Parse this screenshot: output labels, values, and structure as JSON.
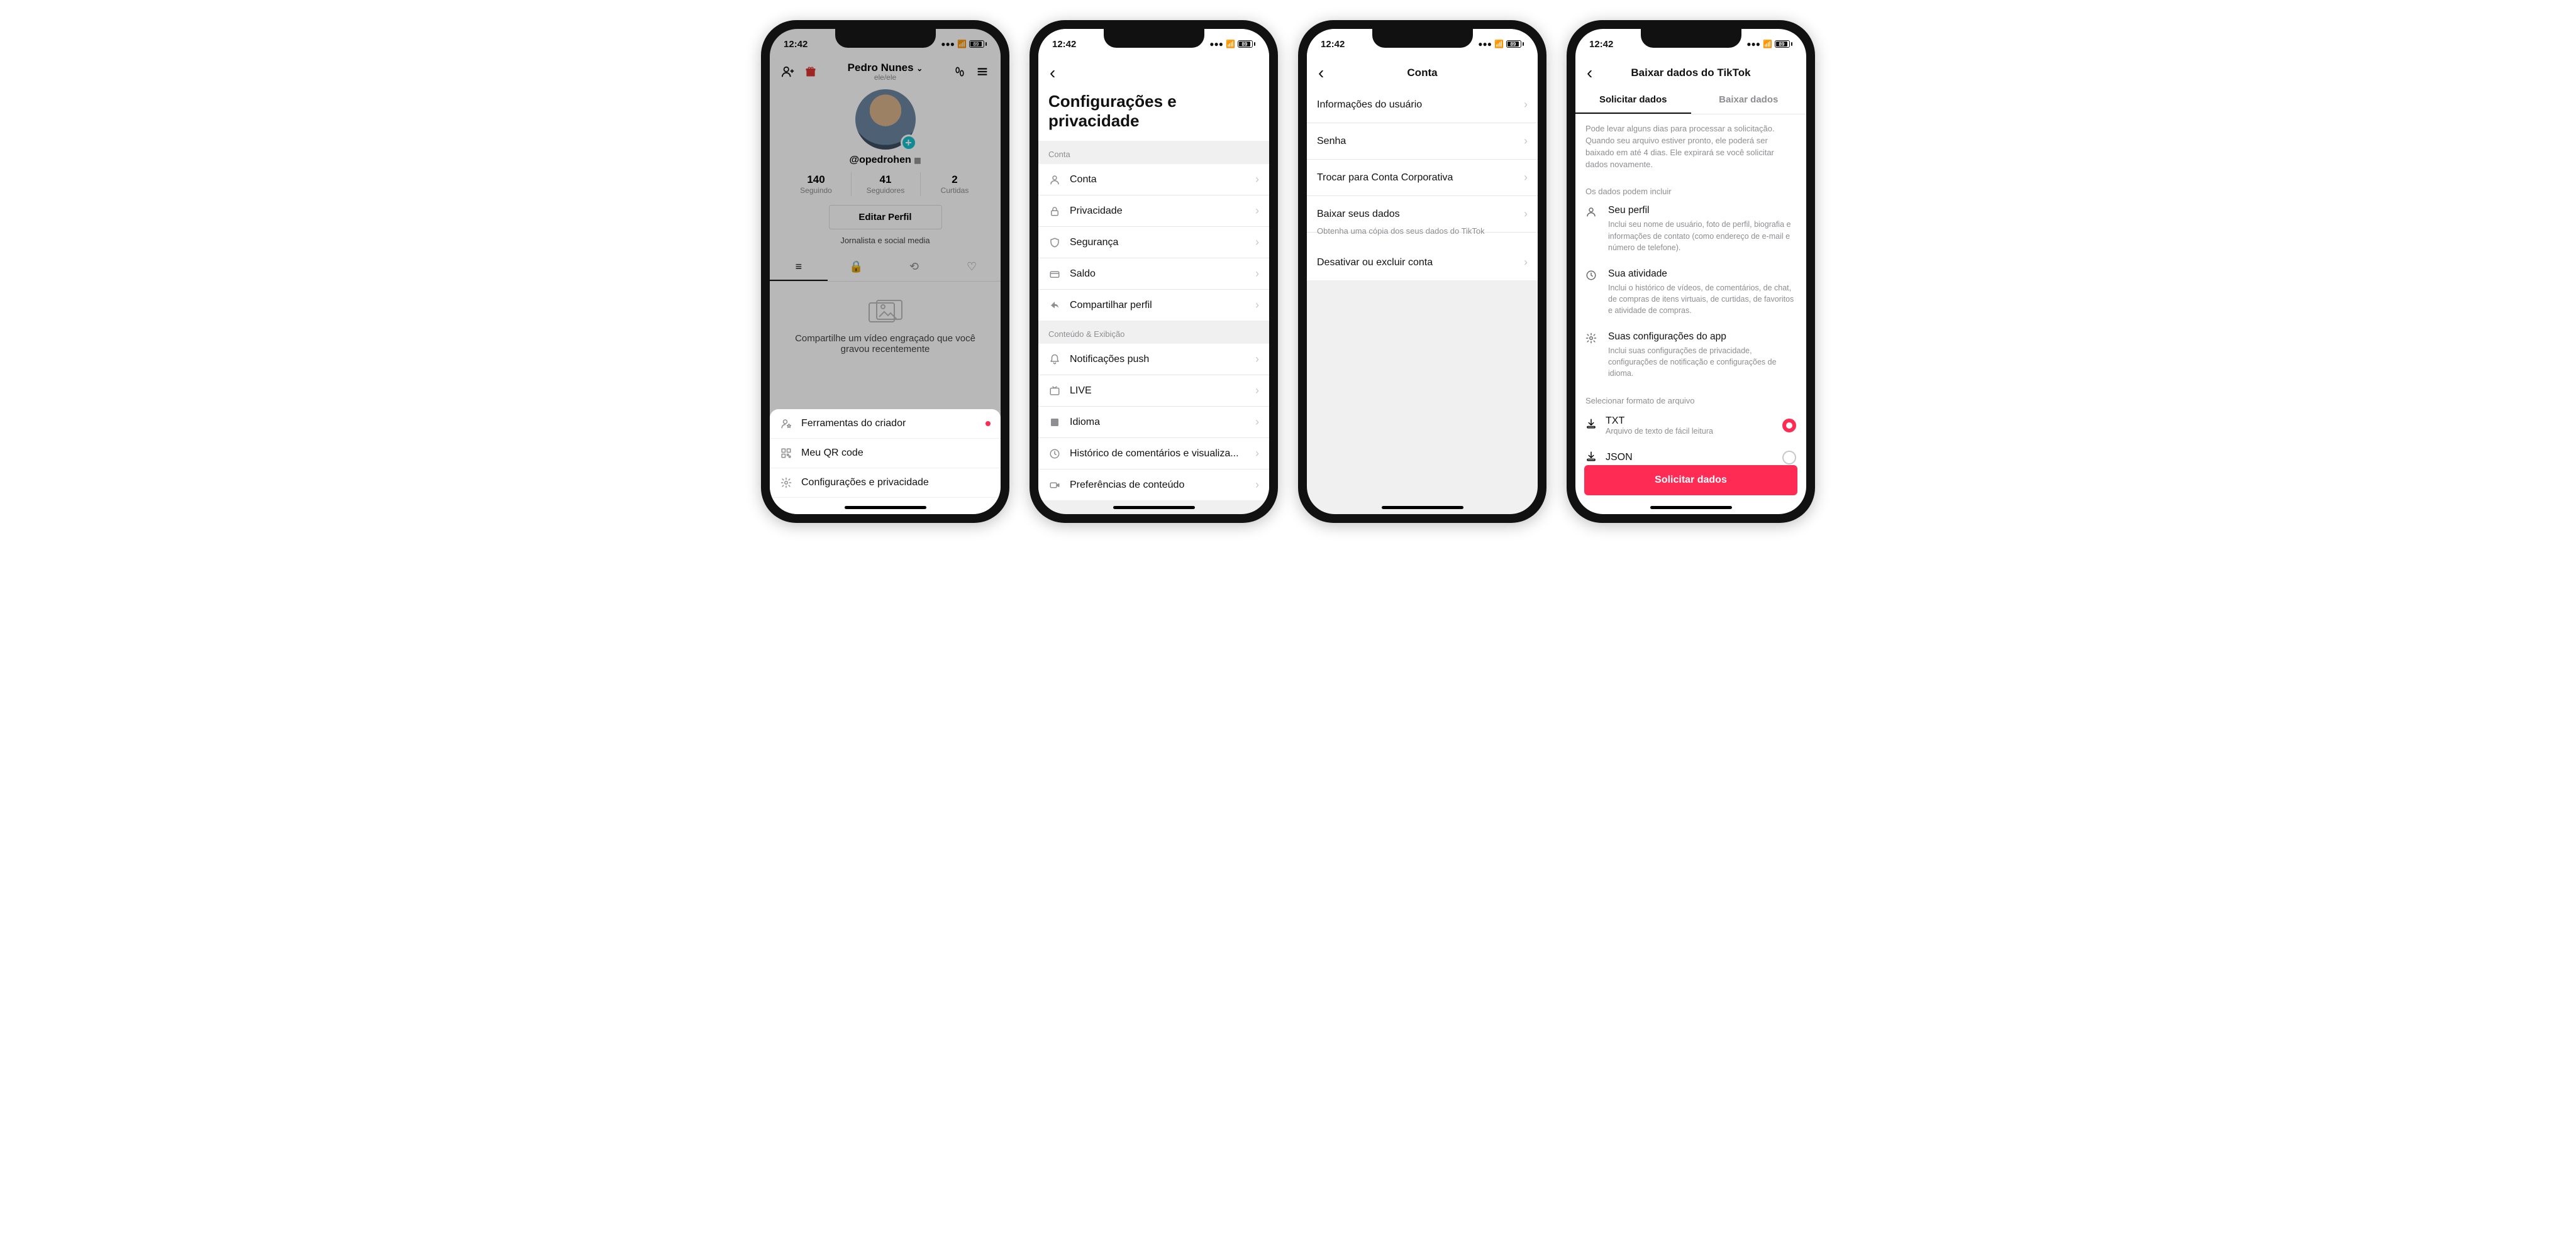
{
  "status": {
    "time": "12:42",
    "battery": "89"
  },
  "screen1": {
    "name": "Pedro Nunes",
    "pronouns": "ele/ele",
    "handle": "@opedrohen",
    "stats": [
      {
        "num": "140",
        "label": "Seguindo"
      },
      {
        "num": "41",
        "label": "Seguidores"
      },
      {
        "num": "2",
        "label": "Curtidas"
      }
    ],
    "edit": "Editar Perfil",
    "bio": "Jornalista e social media",
    "empty_title": "Compartilhe um vídeo engraçado que você gravou recentemente",
    "sheet": [
      {
        "icon": "person-star",
        "label": "Ferramentas do criador",
        "dot": true
      },
      {
        "icon": "qr",
        "label": "Meu QR code"
      },
      {
        "icon": "gear",
        "label": "Configurações e privacidade"
      }
    ]
  },
  "screen2": {
    "title": "Configurações e privacidade",
    "groups": [
      {
        "header": "Conta",
        "items": [
          {
            "icon": "person",
            "label": "Conta"
          },
          {
            "icon": "lock",
            "label": "Privacidade"
          },
          {
            "icon": "shield",
            "label": "Segurança"
          },
          {
            "icon": "wallet",
            "label": "Saldo"
          },
          {
            "icon": "share",
            "label": "Compartilhar perfil"
          }
        ]
      },
      {
        "header": "Conteúdo & Exibição",
        "items": [
          {
            "icon": "bell",
            "label": "Notificações push"
          },
          {
            "icon": "live",
            "label": "LIVE"
          },
          {
            "icon": "lang",
            "label": "Idioma"
          },
          {
            "icon": "clock",
            "label": "Histórico de comentários e visualiza..."
          },
          {
            "icon": "video",
            "label": "Preferências de conteúdo"
          }
        ]
      }
    ]
  },
  "screen3": {
    "title": "Conta",
    "items": [
      {
        "label": "Informações do usuário"
      },
      {
        "label": "Senha"
      },
      {
        "label": "Trocar para Conta Corporativa"
      },
      {
        "label": "Baixar seus dados",
        "sub": "Obtenha uma cópia dos seus dados do TikTok"
      },
      {
        "label": "Desativar ou excluir conta"
      }
    ]
  },
  "screen4": {
    "title": "Baixar dados do TikTok",
    "tabs": [
      "Solicitar dados",
      "Baixar dados"
    ],
    "active_tab": 0,
    "info": "Pode levar alguns dias para processar a solicitação. Quando seu arquivo estiver pronto, ele poderá ser baixado em até 4 dias. Ele expirará se você solicitar dados novamente.",
    "include_header": "Os dados podem incluir",
    "includes": [
      {
        "icon": "person",
        "title": "Seu perfil",
        "desc": "Inclui seu nome de usuário, foto de perfil, biografia e informações de contato (como endereço de e-mail e número de telefone)."
      },
      {
        "icon": "clock",
        "title": "Sua atividade",
        "desc": "Inclui o histórico de vídeos, de comentários, de chat, de compras de itens virtuais, de curtidas, de favoritos e atividade de compras."
      },
      {
        "icon": "gear",
        "title": "Suas configurações do app",
        "desc": "Inclui suas configurações de privacidade, configurações de notificação e configurações de idioma."
      }
    ],
    "format_header": "Selecionar formato de arquivo",
    "formats": [
      {
        "icon": "download",
        "title": "TXT",
        "desc": "Arquivo de texto de fácil leitura",
        "selected": true
      },
      {
        "icon": "download",
        "title": "JSON",
        "desc": "",
        "selected": false
      }
    ],
    "cta": "Solicitar dados"
  },
  "icons": {
    "person": "◉",
    "lock": "🔒",
    "shield": "⛨",
    "wallet": "▭",
    "share": "➦",
    "bell": "🔔",
    "live": "▣",
    "lang": "A",
    "clock": "◷",
    "video": "■",
    "gear": "⚙",
    "qr": "▦",
    "download": "⭳",
    "person-star": "☆"
  }
}
